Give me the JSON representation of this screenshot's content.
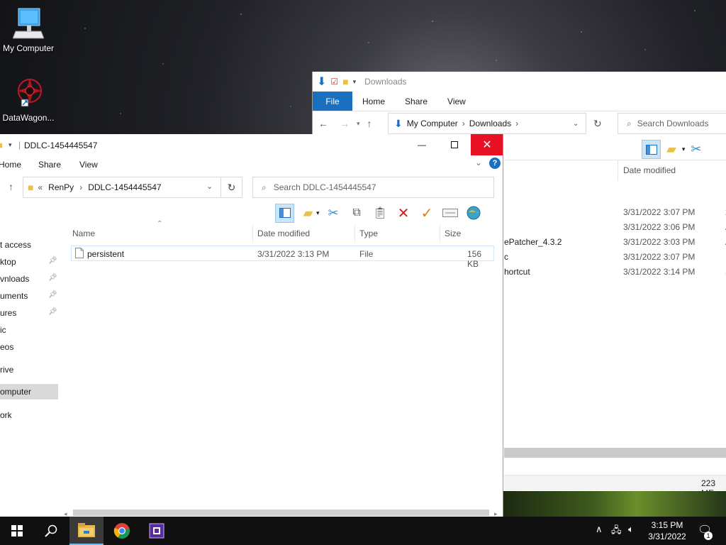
{
  "desktop": {
    "icons": [
      {
        "label": "My Computer",
        "icon": "computer-icon"
      },
      {
        "label": "DataWagon...",
        "icon": "datawagon-shortcut-icon"
      }
    ]
  },
  "downloads_window": {
    "title": "Downloads",
    "ribbon_tabs": [
      "File",
      "Home",
      "Share",
      "View"
    ],
    "breadcrumb": [
      "My Computer",
      "Downloads"
    ],
    "search_placeholder": "Search Downloads",
    "column_date": "Date modified",
    "rows": [
      {
        "name": "",
        "date": "3/31/2022 3:07 PM",
        "type": "2"
      },
      {
        "name": "",
        "date": "3/31/2022 3:06 PM",
        "type": "A"
      },
      {
        "name": "ePatcher_4.3.2",
        "date": "3/31/2022 3:03 PM",
        "type": "A"
      },
      {
        "name": "c",
        "date": "3/31/2022 3:07 PM",
        "type": "I"
      },
      {
        "name": "hortcut",
        "date": "3/31/2022 3:14 PM",
        "type": "S"
      }
    ],
    "status": "223 ME"
  },
  "ddlc_window": {
    "title": "DDLC-1454445547",
    "ribbon_tabs": [
      "Home",
      "Share",
      "View"
    ],
    "breadcrumb_prefix": "«",
    "breadcrumb": [
      "RenPy",
      "DDLC-1454445547"
    ],
    "search_placeholder": "Search DDLC-1454445547",
    "columns": {
      "name": "Name",
      "date": "Date modified",
      "type": "Type",
      "size": "Size"
    },
    "nav_items": [
      {
        "label": "t access",
        "pinned": false,
        "selected": false
      },
      {
        "label": "ktop",
        "pinned": true,
        "selected": false
      },
      {
        "label": "vnloads",
        "pinned": true,
        "selected": false
      },
      {
        "label": "uments",
        "pinned": true,
        "selected": false
      },
      {
        "label": "ures",
        "pinned": true,
        "selected": false
      },
      {
        "label": "ic",
        "pinned": false,
        "selected": false
      },
      {
        "label": "eos",
        "pinned": false,
        "selected": false
      },
      {
        "label": "rive",
        "pinned": false,
        "selected": false
      },
      {
        "label": "omputer",
        "pinned": false,
        "selected": true
      },
      {
        "label": "ork",
        "pinned": false,
        "selected": false
      }
    ],
    "files": [
      {
        "name": "persistent",
        "date": "3/31/2022 3:13 PM",
        "type": "File",
        "size": "156 KB"
      }
    ]
  },
  "taskbar": {
    "apps": [
      "windows-start-icon",
      "search-icon",
      "file-explorer-icon",
      "chrome-icon",
      "app-icon"
    ],
    "time": "3:15 PM",
    "date": "3/31/2022",
    "notification_count": "1"
  },
  "colors": {
    "accent": "#1a6fbf",
    "close_red": "#e81123",
    "selection": "#cde8ff"
  }
}
